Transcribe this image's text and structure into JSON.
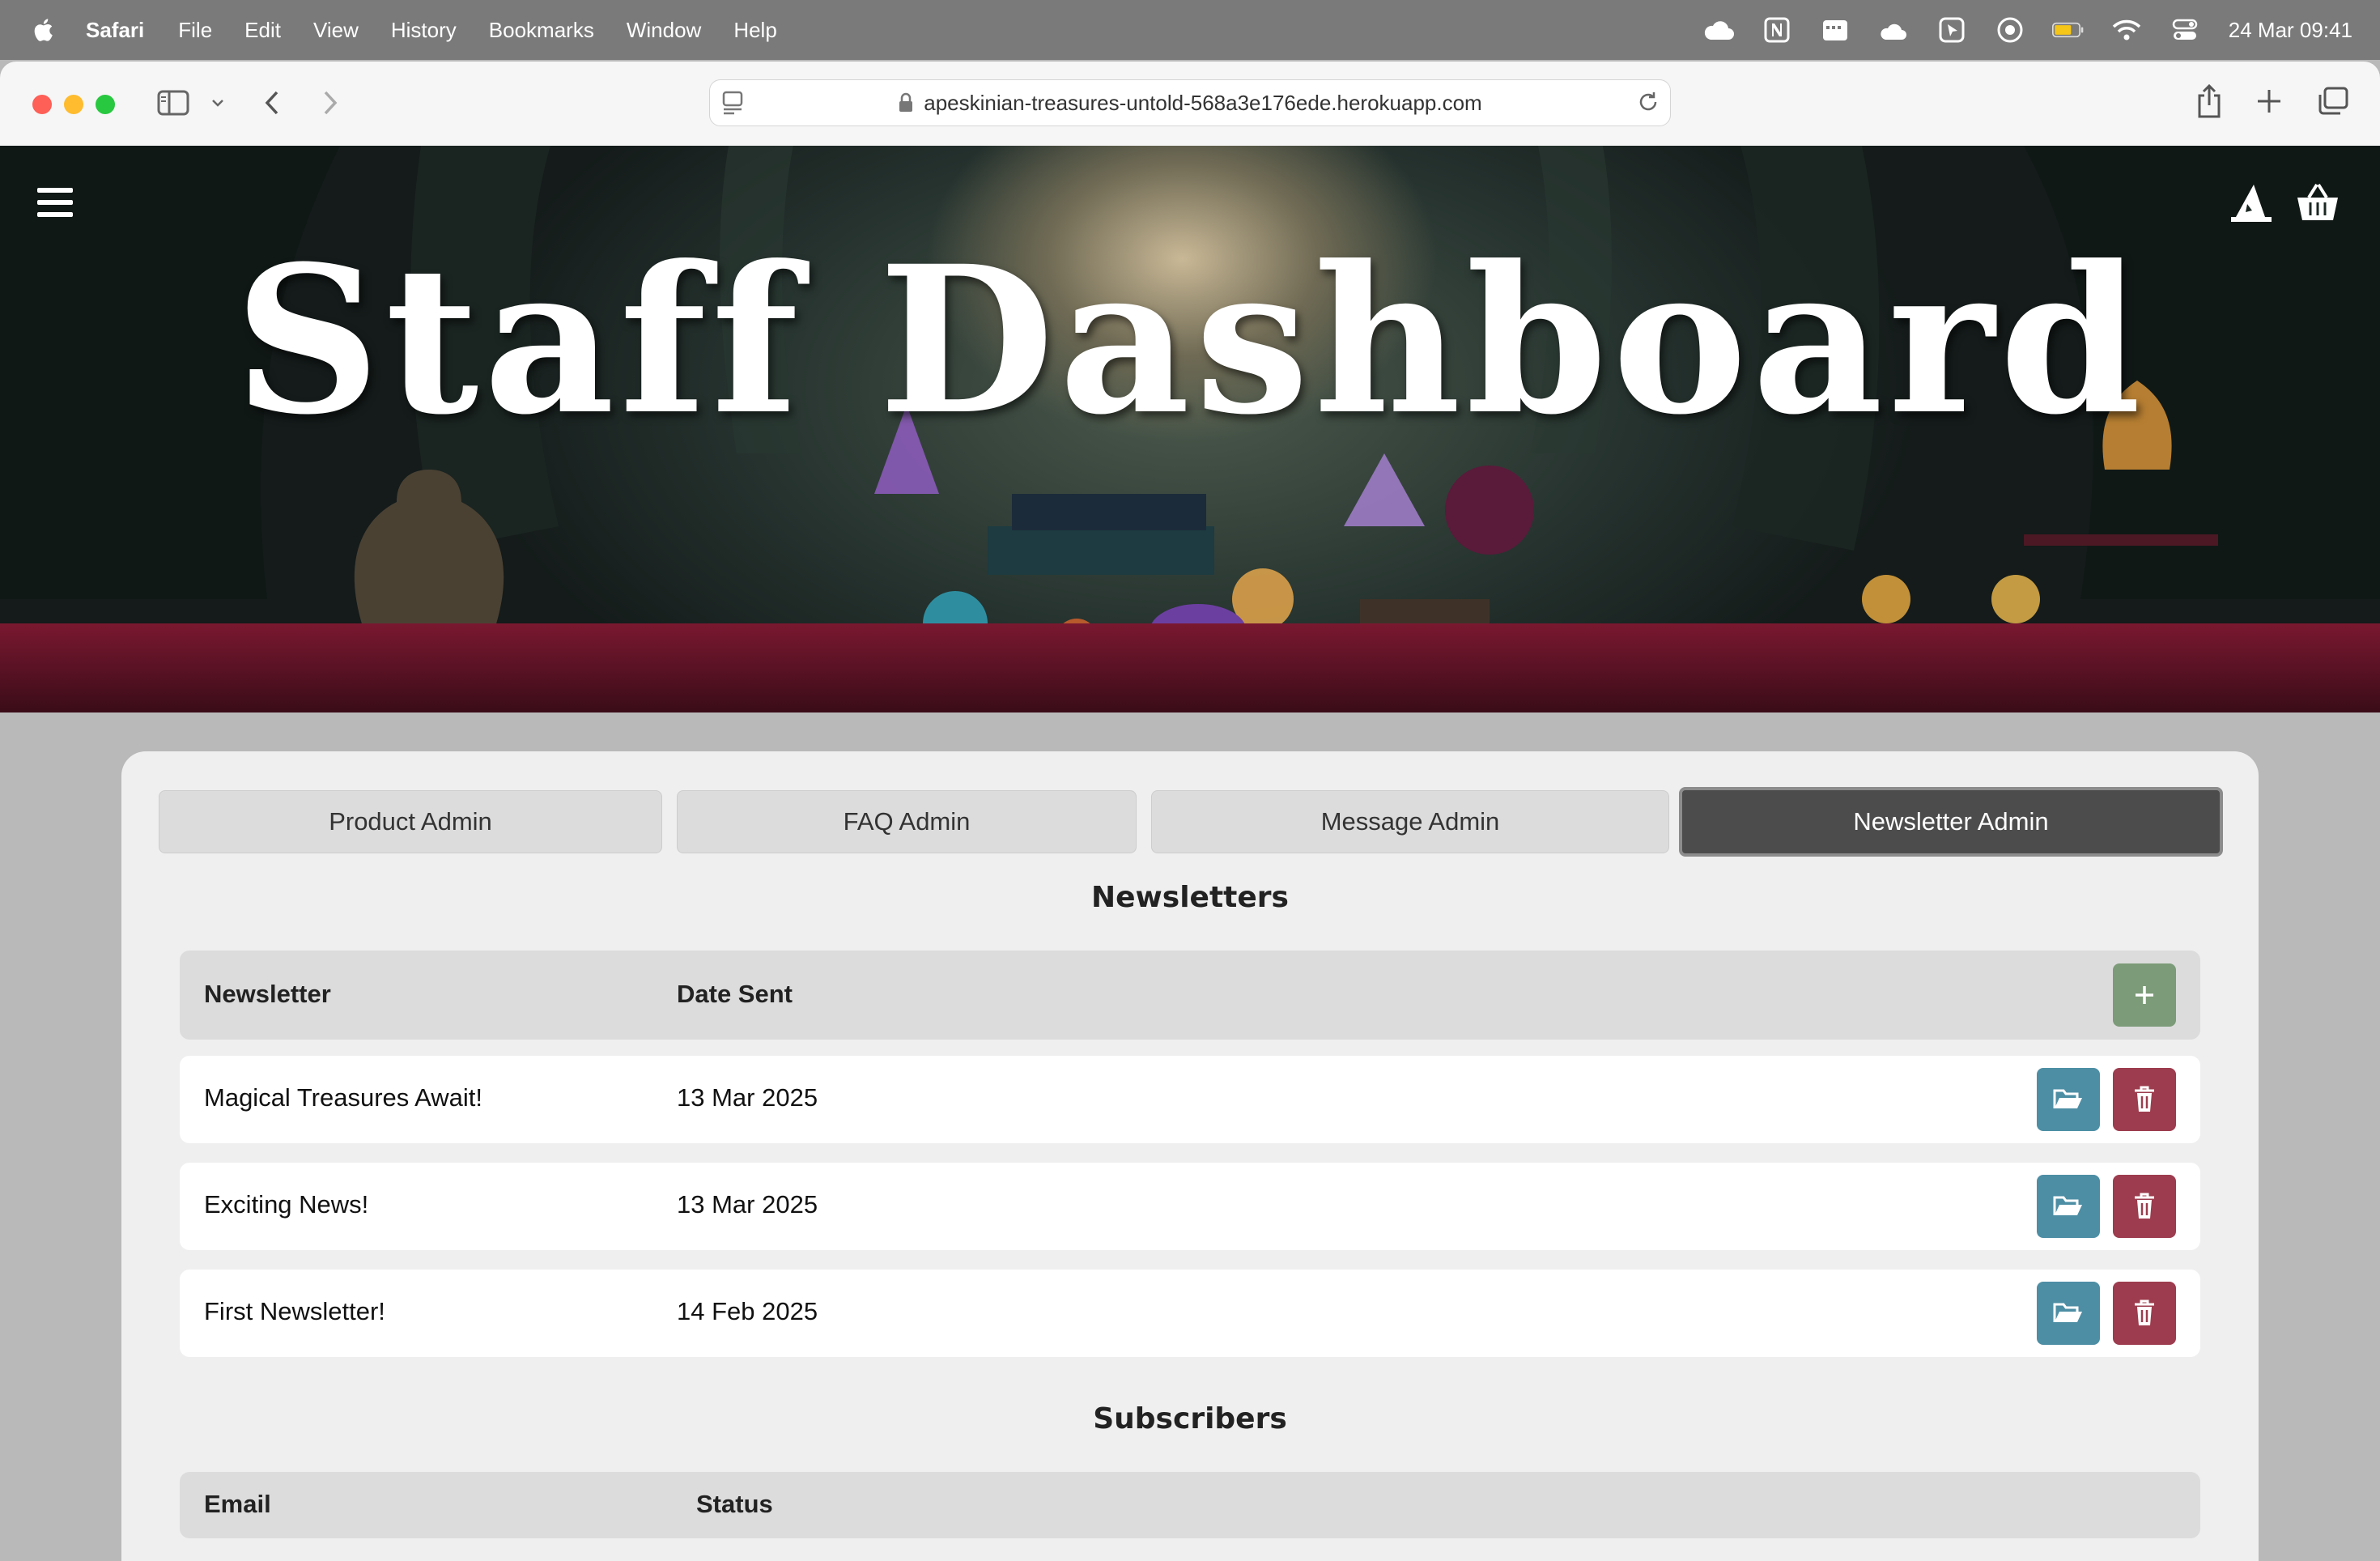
{
  "menubar": {
    "app_name": "Safari",
    "items": [
      "File",
      "Edit",
      "View",
      "History",
      "Bookmarks",
      "Window",
      "Help"
    ],
    "clock": "24 Mar  09:41"
  },
  "browser": {
    "url": "apeskinian-treasures-untold-568a3e176ede.herokuapp.com"
  },
  "hero": {
    "title": "Staff Dashboard"
  },
  "tabs": [
    {
      "label": "Product Admin",
      "active": false
    },
    {
      "label": "FAQ Admin",
      "active": false
    },
    {
      "label": "Message Admin",
      "active": false
    },
    {
      "label": "Newsletter Admin",
      "active": true
    }
  ],
  "newsletters": {
    "title": "Newsletters",
    "columns": [
      "Newsletter",
      "Date Sent"
    ],
    "rows": [
      {
        "name": "Magical Treasures Await!",
        "date": "13 Mar 2025"
      },
      {
        "name": "Exciting News!",
        "date": "13 Mar 2025"
      },
      {
        "name": "First Newsletter!",
        "date": "14 Feb 2025"
      }
    ]
  },
  "subscribers": {
    "title": "Subscribers",
    "columns": [
      "Email",
      "Status"
    ]
  },
  "colors": {
    "add_button": "#7c9b78",
    "open_button": "#4d8ea4",
    "delete_button": "#9c3c4e",
    "active_tab": "#4c4c4c"
  }
}
